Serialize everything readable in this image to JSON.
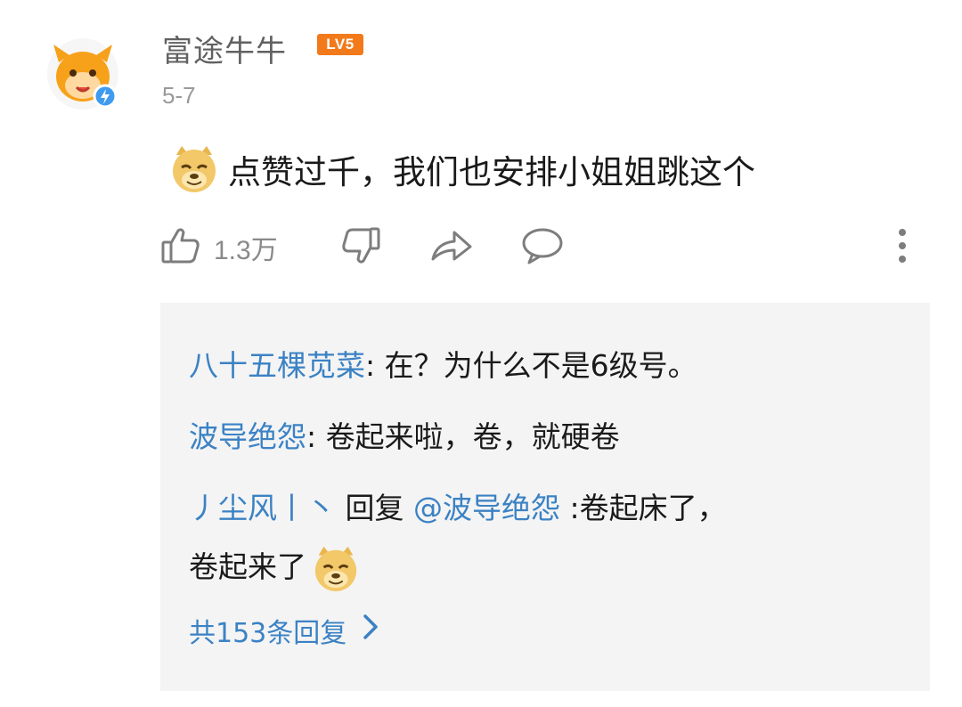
{
  "comment": {
    "username": "富途牛牛",
    "level_badge": "LV5",
    "date": "5-7",
    "text": "点赞过千，我们也安排小姐姐跳这个",
    "likes": "1.3万",
    "icons": [
      "avatar",
      "doge-emoji-icon",
      "thumbs-up-icon",
      "thumbs-down-icon",
      "share-icon",
      "comment-icon",
      "more-icon"
    ]
  },
  "replies": [
    {
      "author": "八十五棵苋菜",
      "text": ": 在？为什么不是6级号。"
    },
    {
      "author": "波导绝怨",
      "text": ": 卷起来啦，卷，就硬卷"
    },
    {
      "author": "丿尘风丨丶",
      "mid": " 回复 ",
      "mention": "@波导绝怨",
      "text": " :卷起床了，",
      "text2": "卷起来了"
    }
  ],
  "more_replies": "共153条回复",
  "colors": {
    "link": "#3b82c4",
    "badge": "#f27a1a",
    "reply_bg": "#f4f4f4"
  }
}
